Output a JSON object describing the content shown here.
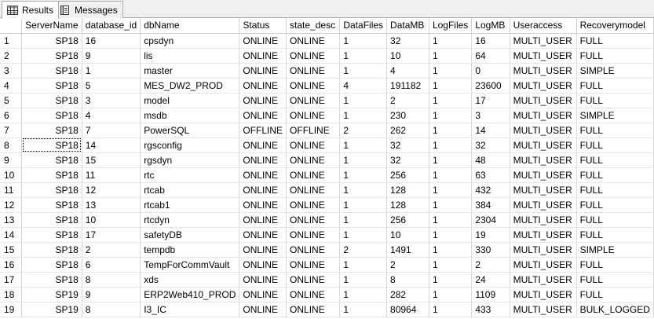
{
  "tabs": [
    {
      "label": "Results",
      "icon": "grid-icon",
      "active": true
    },
    {
      "label": "Messages",
      "icon": "messages-icon",
      "active": false
    }
  ],
  "columns": [
    "ServerName",
    "database_id",
    "dbName",
    "Status",
    "state_desc",
    "DataFiles",
    "DataMB",
    "LogFiles",
    "LogMB",
    "Useraccess",
    "Recoverymodel"
  ],
  "rows": [
    {
      "num": "1",
      "cells": [
        "SP18",
        "16",
        "cpsdyn",
        "ONLINE",
        "ONLINE",
        "1",
        "32",
        "1",
        "16",
        "MULTI_USER",
        "FULL"
      ]
    },
    {
      "num": "2",
      "cells": [
        "SP18",
        "9",
        "lis",
        "ONLINE",
        "ONLINE",
        "1",
        "10",
        "1",
        "64",
        "MULTI_USER",
        "FULL"
      ]
    },
    {
      "num": "3",
      "cells": [
        "SP18",
        "1",
        "master",
        "ONLINE",
        "ONLINE",
        "1",
        "4",
        "1",
        "0",
        "MULTI_USER",
        "SIMPLE"
      ]
    },
    {
      "num": "4",
      "cells": [
        "SP18",
        "5",
        "MES_DW2_PROD",
        "ONLINE",
        "ONLINE",
        "4",
        "191182",
        "1",
        "23600",
        "MULTI_USER",
        "FULL"
      ]
    },
    {
      "num": "5",
      "cells": [
        "SP18",
        "3",
        "model",
        "ONLINE",
        "ONLINE",
        "1",
        "2",
        "1",
        "17",
        "MULTI_USER",
        "FULL"
      ]
    },
    {
      "num": "6",
      "cells": [
        "SP18",
        "4",
        "msdb",
        "ONLINE",
        "ONLINE",
        "1",
        "230",
        "1",
        "3",
        "MULTI_USER",
        "SIMPLE"
      ]
    },
    {
      "num": "7",
      "cells": [
        "SP18",
        "7",
        "PowerSQL",
        "OFFLINE",
        "OFFLINE",
        "2",
        "262",
        "1",
        "14",
        "MULTI_USER",
        "FULL"
      ]
    },
    {
      "num": "8",
      "cells": [
        "SP18",
        "14",
        "rgsconfig",
        "ONLINE",
        "ONLINE",
        "1",
        "32",
        "1",
        "32",
        "MULTI_USER",
        "FULL"
      ]
    },
    {
      "num": "9",
      "cells": [
        "SP18",
        "15",
        "rgsdyn",
        "ONLINE",
        "ONLINE",
        "1",
        "32",
        "1",
        "48",
        "MULTI_USER",
        "FULL"
      ]
    },
    {
      "num": "10",
      "cells": [
        "SP18",
        "11",
        "rtc",
        "ONLINE",
        "ONLINE",
        "1",
        "256",
        "1",
        "63",
        "MULTI_USER",
        "FULL"
      ]
    },
    {
      "num": "11",
      "cells": [
        "SP18",
        "12",
        "rtcab",
        "ONLINE",
        "ONLINE",
        "1",
        "128",
        "1",
        "432",
        "MULTI_USER",
        "FULL"
      ]
    },
    {
      "num": "12",
      "cells": [
        "SP18",
        "13",
        "rtcab1",
        "ONLINE",
        "ONLINE",
        "1",
        "128",
        "1",
        "384",
        "MULTI_USER",
        "FULL"
      ]
    },
    {
      "num": "13",
      "cells": [
        "SP18",
        "10",
        "rtcdyn",
        "ONLINE",
        "ONLINE",
        "1",
        "256",
        "1",
        "2304",
        "MULTI_USER",
        "FULL"
      ]
    },
    {
      "num": "14",
      "cells": [
        "SP18",
        "17",
        "safetyDB",
        "ONLINE",
        "ONLINE",
        "1",
        "10",
        "1",
        "19",
        "MULTI_USER",
        "FULL"
      ]
    },
    {
      "num": "15",
      "cells": [
        "SP18",
        "2",
        "tempdb",
        "ONLINE",
        "ONLINE",
        "2",
        "1491",
        "1",
        "330",
        "MULTI_USER",
        "SIMPLE"
      ]
    },
    {
      "num": "16",
      "cells": [
        "SP18",
        "6",
        "TempForCommVault",
        "ONLINE",
        "ONLINE",
        "1",
        "2",
        "1",
        "2",
        "MULTI_USER",
        "FULL"
      ]
    },
    {
      "num": "17",
      "cells": [
        "SP18",
        "8",
        "xds",
        "ONLINE",
        "ONLINE",
        "1",
        "8",
        "1",
        "24",
        "MULTI_USER",
        "FULL"
      ]
    },
    {
      "num": "18",
      "cells": [
        "SP19",
        "9",
        "ERP2Web410_PROD",
        "ONLINE",
        "ONLINE",
        "1",
        "282",
        "1",
        "1109",
        "MULTI_USER",
        "FULL"
      ]
    },
    {
      "num": "19",
      "cells": [
        "SP19",
        "8",
        "I3_IC",
        "ONLINE",
        "ONLINE",
        "1",
        "80964",
        "1",
        "433",
        "MULTI_USER",
        "BULK_LOGGED"
      ]
    }
  ],
  "selected_cell": {
    "row": 7,
    "col": 0
  },
  "colors": {
    "tab_bg": "#f0f0f0",
    "grid_line": "#d9d9d9",
    "header_border": "#cfcfcf"
  }
}
